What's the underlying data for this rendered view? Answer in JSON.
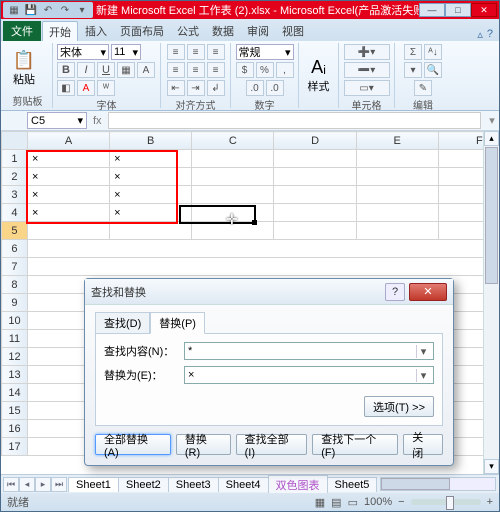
{
  "window": {
    "title": "新建 Microsoft Excel 工作表 (2).xlsx  -  Microsoft Excel(产品激活失败)"
  },
  "ribbon": {
    "file": "文件",
    "tabs": [
      "开始",
      "插入",
      "页面布局",
      "公式",
      "数据",
      "审阅",
      "视图"
    ],
    "groups": {
      "clipboard": "剪贴板",
      "font": "字体",
      "alignment": "对齐方式",
      "number": "数字",
      "styles": "样式",
      "cells": "单元格",
      "editing": "编辑"
    },
    "paste": "粘贴",
    "styles_btn": "样式",
    "font_name": "宋体",
    "font_size": "11",
    "number_format": "常规"
  },
  "namebox": "C5",
  "columns": [
    "A",
    "B",
    "C",
    "D",
    "E",
    "F"
  ],
  "rows": [
    "1",
    "2",
    "3",
    "4",
    "5",
    "6",
    "7",
    "8",
    "9",
    "10",
    "11",
    "12",
    "13",
    "14",
    "15",
    "16",
    "17"
  ],
  "cells": {
    "A1": "×",
    "B1": "×",
    "A2": "×",
    "B2": "×",
    "A3": "×",
    "B3": "×",
    "A4": "×",
    "B4": "×"
  },
  "dialog": {
    "title": "查找和替换",
    "tab_find": "查找(D)",
    "tab_replace": "替换(P)",
    "label_find": "查找内容(N)：",
    "label_replace": "替换为(E)：",
    "value_find": "*",
    "value_replace": "×",
    "options": "选项(T) >>",
    "btn_replace_all": "全部替换(A)",
    "btn_replace": "替换(R)",
    "btn_find_all": "查找全部(I)",
    "btn_find_next": "查找下一个(F)",
    "btn_close": "关闭"
  },
  "sheets": [
    "Sheet1",
    "Sheet2",
    "Sheet3",
    "Sheet4",
    "双色图表",
    "Sheet5"
  ],
  "status": {
    "mode": "就绪",
    "zoom": "100%"
  }
}
